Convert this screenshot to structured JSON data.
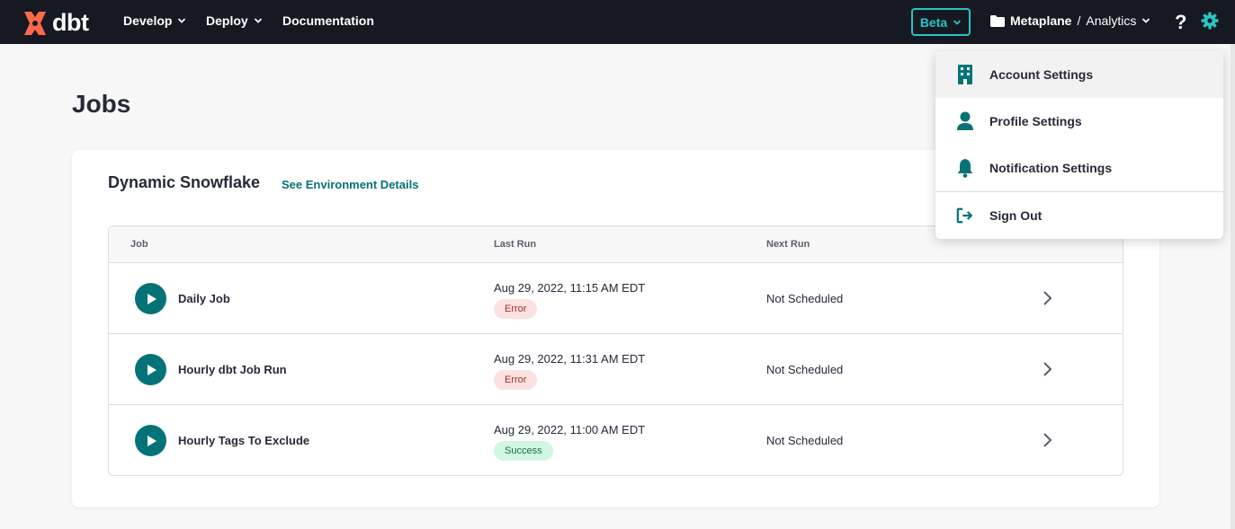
{
  "brand": {
    "name": "dbt",
    "accent": "#fc6a4a",
    "teal": "#047377"
  },
  "nav": {
    "items": [
      {
        "label": "Develop"
      },
      {
        "label": "Deploy"
      },
      {
        "label": "Documentation"
      }
    ],
    "beta_label": "Beta",
    "account": "Metaplane",
    "separator": "/",
    "project": "Analytics",
    "help": "?"
  },
  "page": {
    "title": "Jobs"
  },
  "environment": {
    "name": "Dynamic Snowflake",
    "link_label": "See Environment Details"
  },
  "table": {
    "columns": [
      "Job",
      "Last Run",
      "Next Run"
    ],
    "rows": [
      {
        "name": "Daily Job",
        "last_run": "Aug 29, 2022, 11:15 AM EDT",
        "status": "Error",
        "next_run": "Not Scheduled"
      },
      {
        "name": "Hourly dbt Job Run",
        "last_run": "Aug 29, 2022, 11:31 AM EDT",
        "status": "Error",
        "next_run": "Not Scheduled"
      },
      {
        "name": "Hourly Tags To Exclude",
        "last_run": "Aug 29, 2022, 11:00 AM EDT",
        "status": "Success",
        "next_run": "Not Scheduled"
      }
    ]
  },
  "menu": {
    "items": [
      {
        "label": "Account Settings",
        "icon": "building-icon"
      },
      {
        "label": "Profile Settings",
        "icon": "user-icon"
      },
      {
        "label": "Notification Settings",
        "icon": "bell-icon"
      },
      {
        "label": "Sign Out",
        "icon": "sign-out-icon"
      }
    ]
  }
}
